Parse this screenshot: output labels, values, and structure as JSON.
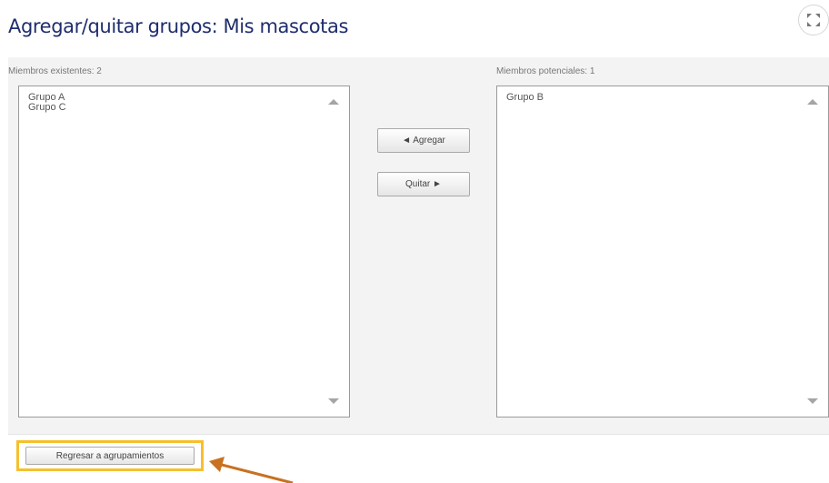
{
  "page": {
    "title": "Agregar/quitar grupos: Mis mascotas"
  },
  "existing": {
    "label": "Miembros existentes: 2",
    "options": [
      "Grupo A",
      "Grupo C"
    ]
  },
  "potential": {
    "label": "Miembros potenciales: 1",
    "options": [
      "Grupo B"
    ]
  },
  "actions": {
    "add_label": "◄ Agregar",
    "remove_label": "Quitar ►"
  },
  "footer": {
    "back_label": "Regresar a agrupamientos"
  },
  "colors": {
    "title": "#1f2d6e",
    "highlight": "#f5c02e",
    "annotation_arrow": "#c8711f"
  },
  "icons": {
    "expand": "expand-icon",
    "scroll_up": "scroll-up-arrow-icon",
    "scroll_down": "scroll-down-arrow-icon",
    "annotation": "annotation-arrow"
  }
}
